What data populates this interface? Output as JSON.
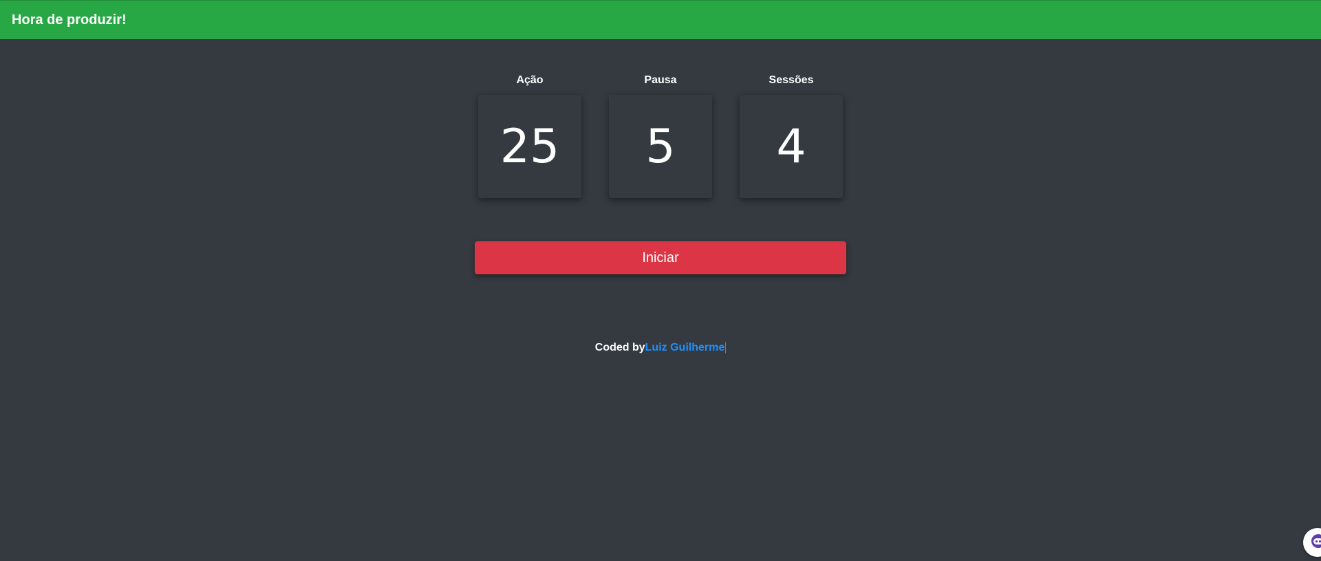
{
  "header": {
    "title": "Hora de produzir!",
    "color": "#28a745"
  },
  "timers": [
    {
      "label": "Ação",
      "value": "25"
    },
    {
      "label": "Pausa",
      "value": "5"
    },
    {
      "label": "Sessões",
      "value": "4"
    }
  ],
  "start_button": {
    "label": "Iniciar",
    "color": "#dc3545"
  },
  "footer": {
    "prefix": "Coded by",
    "author": "Luiz Guilherme",
    "link_color": "#1e90ff"
  },
  "floating_widget": {
    "icon": "assistant-face-icon"
  },
  "theme": {
    "background": "#343a40"
  }
}
